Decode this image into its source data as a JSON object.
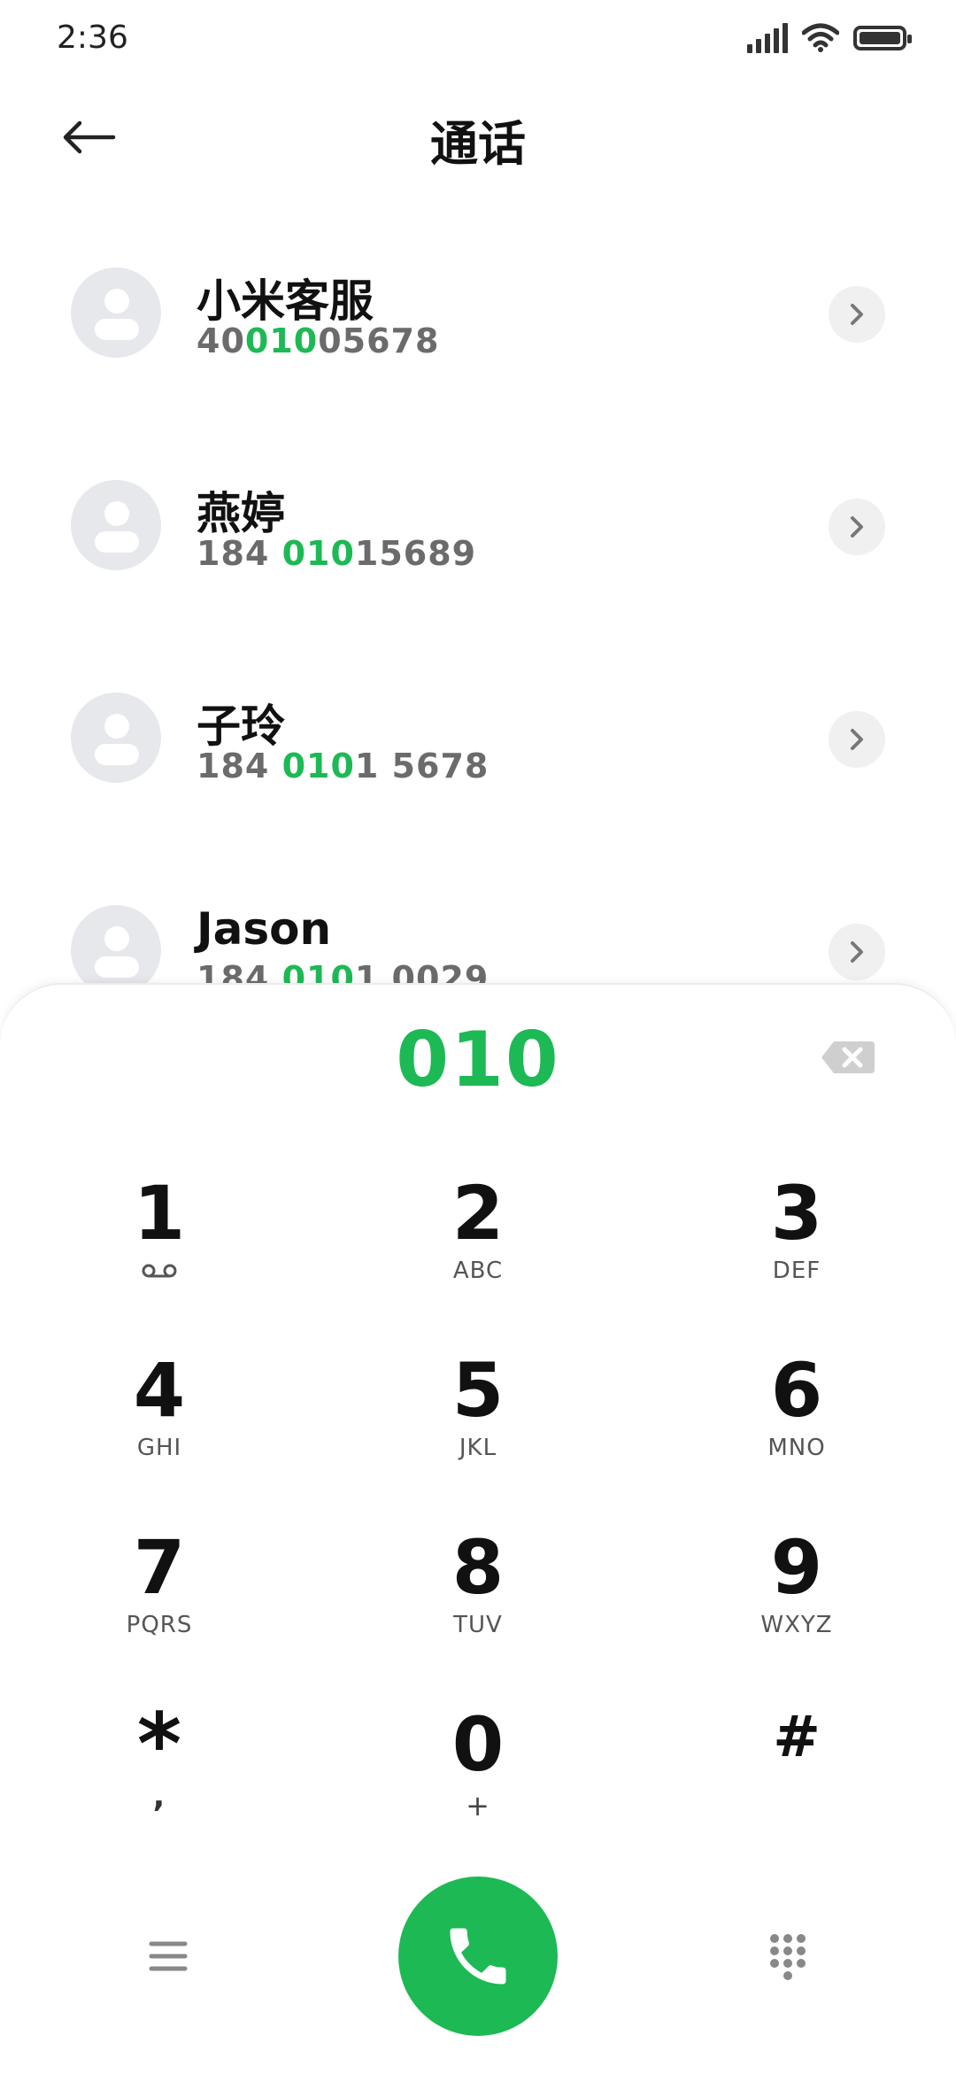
{
  "status": {
    "time": "2:36"
  },
  "header": {
    "title": "通话"
  },
  "contacts": [
    {
      "name": "小米客服",
      "number_pre": "40",
      "number_hl": "010",
      "number_post": "05678"
    },
    {
      "name": "燕婷",
      "number_pre": "184 ",
      "number_hl": "010",
      "number_post": "15689"
    },
    {
      "name": "子玲",
      "number_pre": "184 ",
      "number_hl": "010",
      "number_post": "1 5678"
    },
    {
      "name": "Jason",
      "number_pre": "184 ",
      "number_hl": "010",
      "number_post": "1 0029"
    }
  ],
  "dialer": {
    "input": "010",
    "keys": [
      {
        "digit": "1",
        "letters": ""
      },
      {
        "digit": "2",
        "letters": "ABC"
      },
      {
        "digit": "3",
        "letters": "DEF"
      },
      {
        "digit": "4",
        "letters": "GHI"
      },
      {
        "digit": "5",
        "letters": "JKL"
      },
      {
        "digit": "6",
        "letters": "MNO"
      },
      {
        "digit": "7",
        "letters": "PQRS"
      },
      {
        "digit": "8",
        "letters": "TUV"
      },
      {
        "digit": "9",
        "letters": "WXYZ"
      },
      {
        "digit": "*",
        "letters": ","
      },
      {
        "digit": "0",
        "letters": "+"
      },
      {
        "digit": "#",
        "letters": ""
      }
    ]
  },
  "colors": {
    "accent": "#1db954",
    "avatar_bg": "#e6e8ec",
    "number_gray": "#6b6b6b"
  },
  "icons": {
    "back": "arrow-left-icon",
    "chevron": "chevron-right-icon",
    "backspace": "backspace-icon",
    "voicemail": "voicemail-icon",
    "menu": "menu-icon",
    "call": "phone-icon",
    "keypad": "dialpad-icon"
  }
}
